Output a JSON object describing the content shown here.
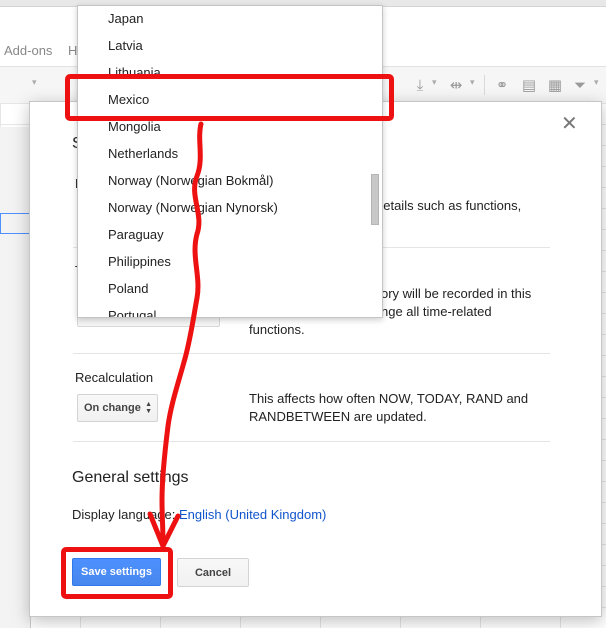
{
  "app": {
    "menu": [
      "Add-ons",
      "H"
    ],
    "colors": {
      "accent_blue": "#4d90fe",
      "link": "#1155cc",
      "annotation": "#ee1111"
    }
  },
  "dialog": {
    "title_peek": "S",
    "locale_peek": "L",
    "timezone_peek": "T",
    "locale_desc": "details such as functions,",
    "timezone_desc": {
      "line1": "ory will be recorded in this",
      "line2": "nge all time-related",
      "line3": "functions."
    },
    "recalc": {
      "label": "Recalculation",
      "value": "On change",
      "desc": "This affects how often NOW, TODAY, RAND and RANDBETWEEN are updated."
    },
    "general": {
      "title": "General settings",
      "display_language_label": "Display language:",
      "display_language_value": "English (United Kingdom)"
    },
    "buttons": {
      "save": "Save settings",
      "cancel": "Cancel"
    },
    "close_icon": "close-icon"
  },
  "dropdown": {
    "selected": "Mexico",
    "items": [
      "Japan",
      "Latvia",
      "Lithuania",
      "Mexico",
      "Mongolia",
      "Netherlands",
      "Norway (Norwegian Bokmål)",
      "Norway (Norwegian Nynorsk)",
      "Paraguay",
      "Philippines",
      "Poland",
      "Portugal"
    ]
  }
}
